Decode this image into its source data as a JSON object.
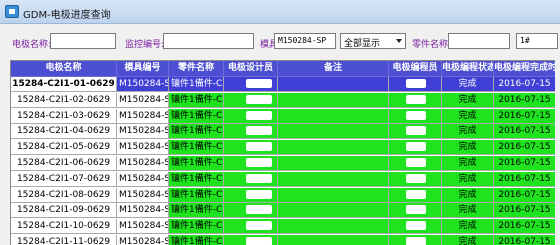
{
  "window": {
    "title": "GDM-电极进度查询"
  },
  "filters": {
    "electrode_label": "电极名称:",
    "electrode_value": "",
    "monitor_label": "监控编号:",
    "monitor_value": "",
    "mold_label": "模具编号:",
    "mold_value": "M150284-SP",
    "display_select": "全部显示",
    "part_label": "零件名称:",
    "part_value": "",
    "extra_value": "1#"
  },
  "table": {
    "headers": [
      "电极名称",
      "模具编号",
      "零件名称",
      "电极设计员",
      "备注",
      "电极编程员",
      "电极编程状态",
      "电极编程完成时间"
    ],
    "rows": [
      {
        "name": "15284-C2I1-01-0629",
        "code": "M150284-SP",
        "part": "镶件1備件-C",
        "status": "完成",
        "date": "2016-07-15",
        "selected": true
      },
      {
        "name": "15284-C2I1-02-0629",
        "code": "M150284-SP",
        "part": "镶件1備件-C",
        "status": "完成",
        "date": "2016-07-15",
        "selected": false
      },
      {
        "name": "15284-C2I1-03-0629",
        "code": "M150284-SP",
        "part": "镶件1備件-C",
        "status": "完成",
        "date": "2016-07-15",
        "selected": false
      },
      {
        "name": "15284-C2I1-04-0629",
        "code": "M150284-SP",
        "part": "镶件1備件-C",
        "status": "完成",
        "date": "2016-07-15",
        "selected": false
      },
      {
        "name": "15284-C2I1-05-0629",
        "code": "M150284-SP",
        "part": "镶件1備件-C",
        "status": "完成",
        "date": "2016-07-15",
        "selected": false
      },
      {
        "name": "15284-C2I1-06-0629",
        "code": "M150284-SP",
        "part": "镶件1備件-C",
        "status": "完成",
        "date": "2016-07-15",
        "selected": false
      },
      {
        "name": "15284-C2I1-07-0629",
        "code": "M150284-SP",
        "part": "镶件1備件-C",
        "status": "完成",
        "date": "2016-07-15",
        "selected": false
      },
      {
        "name": "15284-C2I1-08-0629",
        "code": "M150284-SP",
        "part": "镶件1備件-C",
        "status": "完成",
        "date": "2016-07-15",
        "selected": false
      },
      {
        "name": "15284-C2I1-09-0629",
        "code": "M150284-SP",
        "part": "镶件1備件-C",
        "status": "完成",
        "date": "2016-07-15",
        "selected": false
      },
      {
        "name": "15284-C2I1-10-0629",
        "code": "M150284-SP",
        "part": "镶件1備件-C",
        "status": "完成",
        "date": "2016-07-15",
        "selected": false
      },
      {
        "name": "15284-C2I1-11-0629",
        "code": "M150284-SP",
        "part": "镶件1備件-C",
        "status": "完成",
        "date": "2016-07-15",
        "selected": false
      }
    ]
  },
  "colors": {
    "header": "#4c4fd1",
    "selected": "#4040d6",
    "complete": "#1ee31e",
    "label": "#7b1fa2"
  }
}
